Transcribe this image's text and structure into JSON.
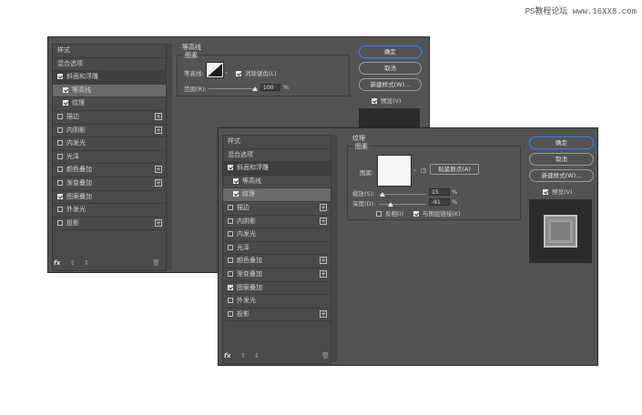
{
  "watermark": "PS教程论坛 www.16XX8.com",
  "style_list": [
    {
      "label": "样式",
      "kind": "header",
      "checkbox": null,
      "plus": false
    },
    {
      "label": "混合选项",
      "kind": "header",
      "checkbox": null,
      "plus": false
    },
    {
      "label": "斜面和浮雕",
      "kind": "item",
      "checkbox": true,
      "plus": false,
      "selected": true
    },
    {
      "label": "等高线",
      "kind": "sub",
      "checkbox": true,
      "plus": false
    },
    {
      "label": "纹理",
      "kind": "sub",
      "checkbox": true,
      "plus": false
    },
    {
      "label": "描边",
      "kind": "item",
      "checkbox": false,
      "plus": true
    },
    {
      "label": "内阴影",
      "kind": "item",
      "checkbox": false,
      "plus": true
    },
    {
      "label": "内发光",
      "kind": "item",
      "checkbox": false,
      "plus": false
    },
    {
      "label": "光泽",
      "kind": "item",
      "checkbox": false,
      "plus": false
    },
    {
      "label": "颜色叠加",
      "kind": "item",
      "checkbox": false,
      "plus": true
    },
    {
      "label": "渐变叠加",
      "kind": "item",
      "checkbox": false,
      "plus": true
    },
    {
      "label": "图案叠加",
      "kind": "item",
      "checkbox": true,
      "plus": false
    },
    {
      "label": "外发光",
      "kind": "item",
      "checkbox": false,
      "plus": false
    },
    {
      "label": "投影",
      "kind": "item",
      "checkbox": false,
      "plus": true
    }
  ],
  "footer": {
    "fx": "fx",
    "up": "⇧",
    "down": "⇩",
    "trash": "🗑"
  },
  "back_dialog": {
    "section_title": "等高线",
    "group_title": "图素",
    "contour_label": "等高线:",
    "anti_alias_label": "消除锯齿(L)",
    "anti_alias_checked": true,
    "range_label": "范围(R):",
    "range_value": "100",
    "range_unit": "%",
    "range_fraction": 1.0
  },
  "front_dialog": {
    "section_title": "纹理",
    "group_title": "图素",
    "pattern_label": "图案:",
    "snap_button": "贴紧原点(A)",
    "scale_label": "缩放(S):",
    "scale_value": "15",
    "scale_unit": "%",
    "depth_label": "深度(D):",
    "depth_value": "-91",
    "depth_unit": "%",
    "invert_label": "反相(I)",
    "invert_checked": false,
    "link_label": "与图层链接(K)",
    "link_checked": true
  },
  "buttons": {
    "ok": "确定",
    "cancel": "取消",
    "new_style": "新建样式(W)...",
    "preview_label": "预览(V)",
    "preview_checked": true
  },
  "colors": {
    "panel": "#535353",
    "list": "#4a4a4a",
    "accent": "#4f78b8",
    "text": "#d6d6d6"
  }
}
